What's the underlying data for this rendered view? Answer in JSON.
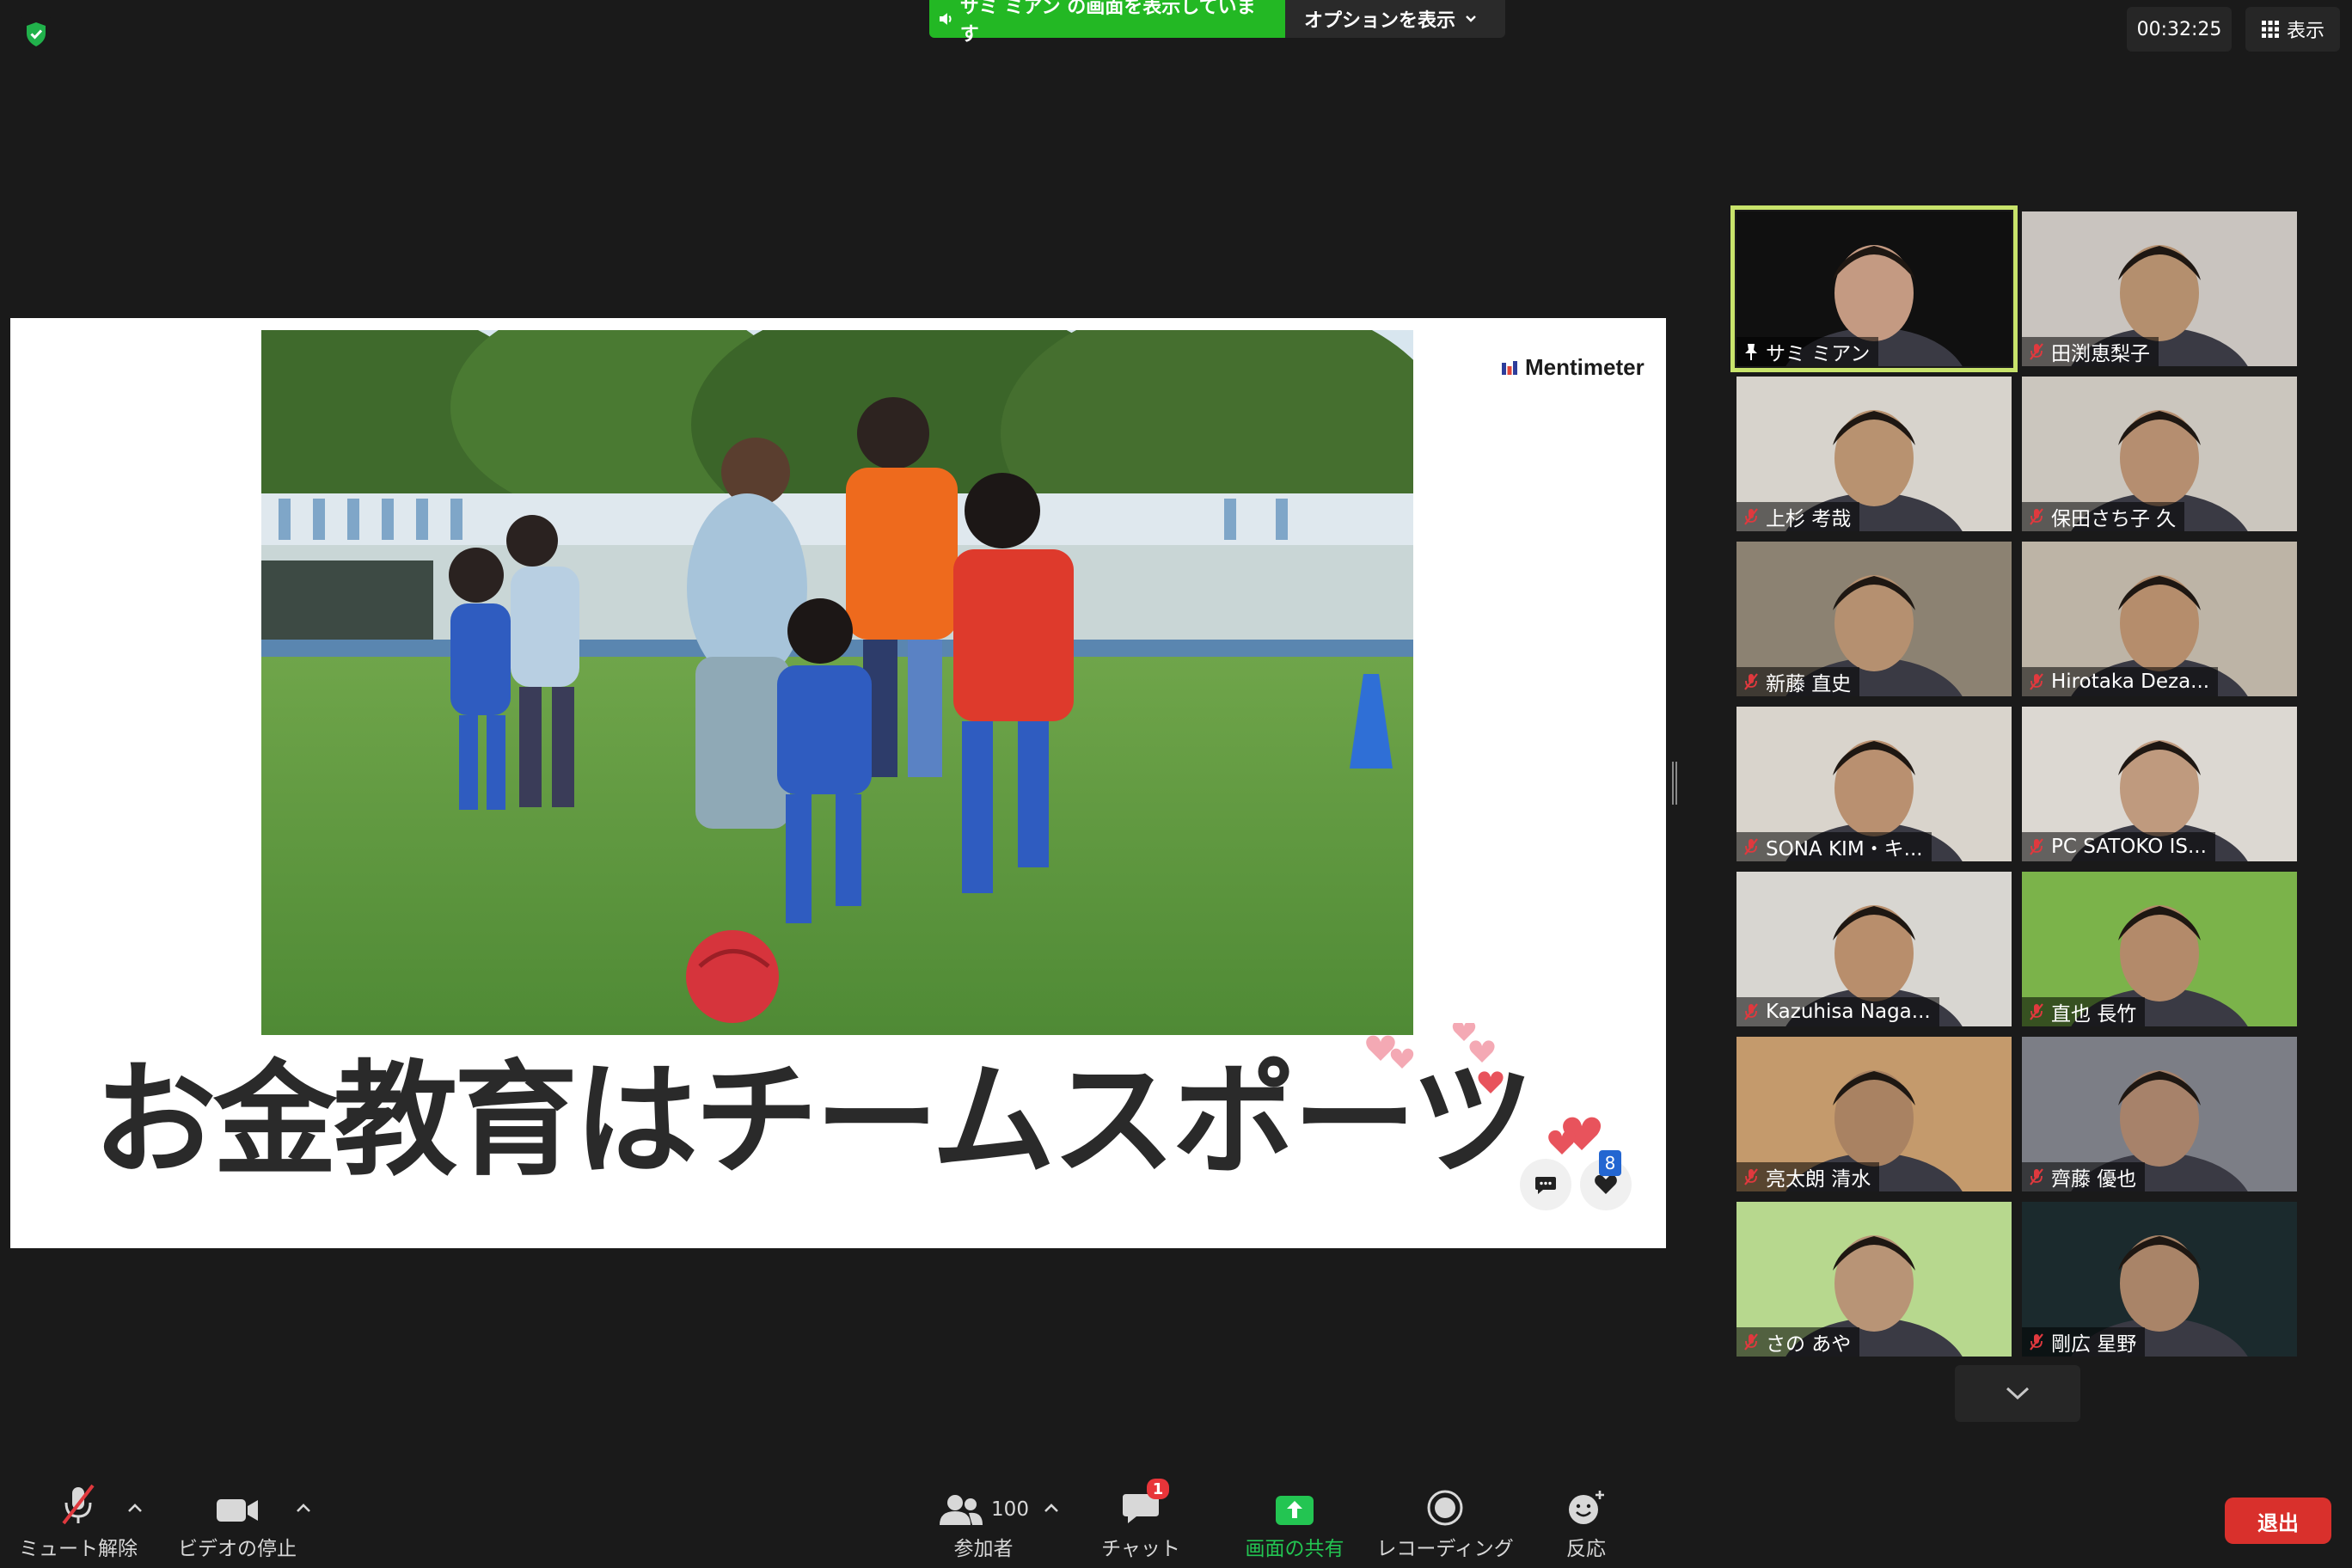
{
  "topbar": {
    "share_status": "サミ ミアン の画面を表示しています",
    "options_label": "オプションを表示",
    "timer": "00:32:25",
    "view_label": "表示"
  },
  "slide": {
    "brand": "Mentimeter",
    "title": "お金教育はチームスポーツ",
    "reaction_count": "8"
  },
  "participants": [
    {
      "name": "サミ ミアン",
      "pinned": true,
      "muted": false,
      "active": true
    },
    {
      "name": "田渕恵梨子",
      "muted": true
    },
    {
      "name": "上杉 考哉",
      "muted": true
    },
    {
      "name": "保田さち子 久",
      "muted": true
    },
    {
      "name": "新藤 直史",
      "muted": true
    },
    {
      "name": "Hirotaka Deza...",
      "muted": true
    },
    {
      "name": "SONA KIM・キ...",
      "muted": true
    },
    {
      "name": "PC SATOKO IS...",
      "muted": true
    },
    {
      "name": "Kazuhisa Naga...",
      "muted": true
    },
    {
      "name": "直也 長竹",
      "muted": true
    },
    {
      "name": "亮太朗 清水",
      "muted": true
    },
    {
      "name": "齊藤 優也",
      "muted": true
    },
    {
      "name": "さの あや",
      "muted": true
    },
    {
      "name": "剛広 星野",
      "muted": true
    }
  ],
  "toolbar": {
    "unmute": "ミュート解除",
    "stop_video": "ビデオの停止",
    "participants_count": "100",
    "participants": "参加者",
    "chat": "チャット",
    "chat_badge": "1",
    "share_screen": "画面の共有",
    "recording": "レコーディング",
    "reactions": "反応",
    "leave": "退出"
  },
  "colors": {
    "share_green": "#23b824",
    "active_speaker": "#c8e36b",
    "leave_red": "#d9302c",
    "muted_red": "#e0393e"
  }
}
